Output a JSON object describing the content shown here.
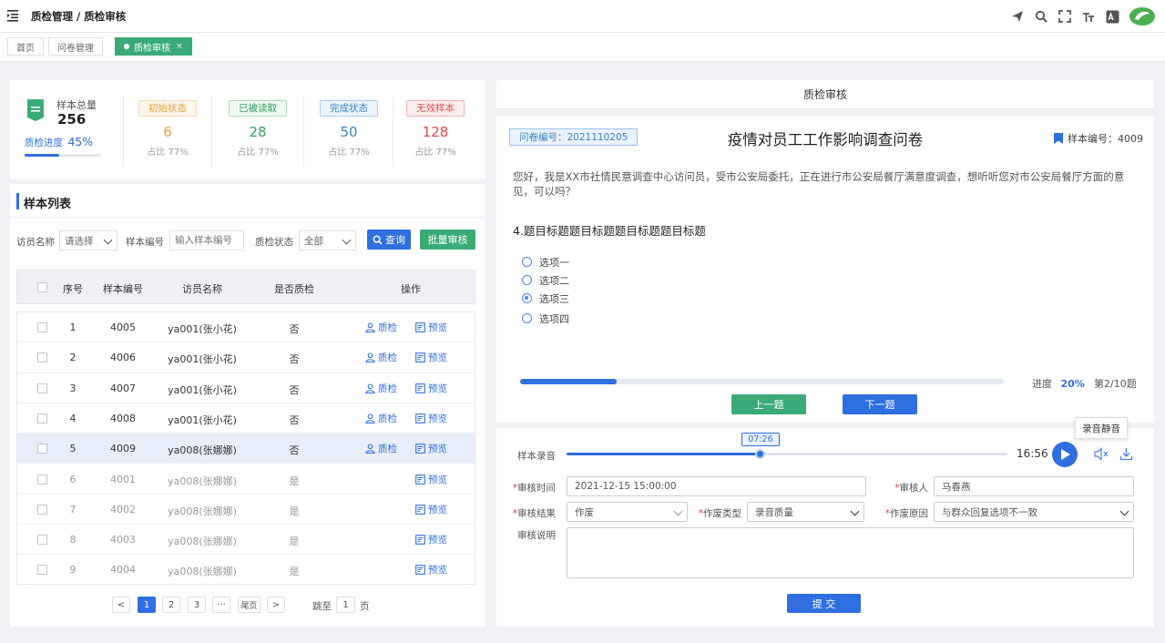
{
  "header": {
    "breadcrumb": "质检管理 / 质检审核",
    "icons": [
      "send-icon",
      "search-icon",
      "fullscreen-icon",
      "font-size-icon",
      "translate-icon",
      "avatar"
    ]
  },
  "tags": {
    "home": "首页",
    "questionnaire": "问卷管理",
    "review": "质检审核",
    "close": "×"
  },
  "stats": {
    "total_label": "样本总量",
    "total_value": "256",
    "progress_label": "质检进度",
    "progress_value": "45%",
    "progress_fraction": 0.45,
    "blocks": [
      {
        "badge": "初始状态",
        "value": "6",
        "ratio": "占比 77%",
        "color": "#e6a23c",
        "bg": "#fdf6ec",
        "border": "#f5dab1"
      },
      {
        "badge": "已被读取",
        "value": "28",
        "ratio": "占比 77%",
        "color": "#2e9e5b",
        "bg": "#eef8f1",
        "border": "#a9dbb9"
      },
      {
        "badge": "完成状态",
        "value": "50",
        "ratio": "占比 77%",
        "color": "#3b82c4",
        "bg": "#ecf5fc",
        "border": "#a9cfee"
      },
      {
        "badge": "无效样本",
        "value": "128",
        "ratio": "占比 77%",
        "color": "#e04b4b",
        "bg": "#fdeeee",
        "border": "#f3b3b3"
      }
    ]
  },
  "list": {
    "title": "样本列表",
    "filters": {
      "interviewer_label": "访员名称",
      "interviewer_value": "请选择",
      "sample_no_label": "样本编号",
      "sample_no_placeholder": "输入样本编号",
      "status_label": "质检状态",
      "status_value": "全部",
      "query_button": "查询",
      "batch_button": "批量审核"
    },
    "columns": [
      "序号",
      "样本编号",
      "访员名称",
      "是否质检",
      "操作"
    ],
    "rows": [
      {
        "idx": "1",
        "no": "4005",
        "name": "ya001(张小花)",
        "checked": "否",
        "qc": "质检",
        "preview": "预览"
      },
      {
        "idx": "2",
        "no": "4006",
        "name": "ya001(张小花)",
        "checked": "否",
        "qc": "质检",
        "preview": "预览"
      },
      {
        "idx": "3",
        "no": "4007",
        "name": "ya001(张小花)",
        "checked": "否",
        "qc": "质检",
        "preview": "预览"
      },
      {
        "idx": "4",
        "no": "4008",
        "name": "ya001(张小花)",
        "checked": "否",
        "qc": "质检",
        "preview": "预览"
      },
      {
        "idx": "5",
        "no": "4009",
        "name": "ya008(张娜娜)",
        "checked": "否",
        "qc": "质检",
        "preview": "预览"
      },
      {
        "idx": "6",
        "no": "4001",
        "name": "ya008(张娜娜)",
        "checked": "是",
        "qc": "",
        "preview": "预览"
      },
      {
        "idx": "7",
        "no": "4002",
        "name": "ya008(张娜娜)",
        "checked": "是",
        "qc": "",
        "preview": "预览"
      },
      {
        "idx": "8",
        "no": "4003",
        "name": "ya008(张娜娜)",
        "checked": "是",
        "qc": "",
        "preview": "预览"
      },
      {
        "idx": "9",
        "no": "4004",
        "name": "ya008(张娜娜)",
        "checked": "是",
        "qc": "",
        "preview": "预览"
      }
    ],
    "pagination": {
      "prev": "<",
      "pages": [
        "1",
        "2",
        "3"
      ],
      "ellipsis": "···",
      "last": "尾页",
      "next": ">",
      "goto_label": "跳至",
      "goto_value": "1",
      "page_unit": "页"
    }
  },
  "review": {
    "title": "质检审核",
    "questionnaire_no": "问卷编号：2021110205",
    "questionnaire_title": "疫情对员工工作影响调查问卷",
    "sample_no": "样本编号：4009",
    "intro": "您好，我是XX市社情民意调查中心访问员，受市公安局委托，正在进行市公安局餐厅满意度调查，想听听您对市公安局餐厅方面的意见，可以吗？",
    "question": "4.题目标题题目标题题目标题题目标题",
    "options": [
      {
        "label": "选项一",
        "checked": false
      },
      {
        "label": "选项二",
        "checked": false
      },
      {
        "label": "选项三",
        "checked": true
      },
      {
        "label": "选项四",
        "checked": false
      }
    ],
    "progress_label": "进度",
    "progress_value": "20%",
    "progress_fraction": 0.2,
    "page_info": "第2/10题",
    "prev_button": "上一题",
    "next_button": "下一题"
  },
  "audit": {
    "audio_label": "样本录音",
    "audio_current": "07:26",
    "audio_total": "16:56",
    "audio_fraction": 0.44,
    "mute_tooltip": "录音静音",
    "time_label": "审核时间",
    "time_value": "2021-12-15  15:00:00",
    "reviewer_label": "审核人",
    "reviewer_value": "马春燕",
    "result_label": "审核结果",
    "result_value": "作废",
    "void_type_label": "作废类型",
    "void_type_value": "录音质量",
    "void_reason_label": "作废原因",
    "void_reason_value": "与群众回复选项不一致",
    "note_label": "审核说明",
    "note_value": "",
    "submit_button": "提  交",
    "required_mark": "*"
  },
  "colors": {
    "primary": "#2f6fe0",
    "green": "#3aab78",
    "brand_avatar": "#4caf50"
  }
}
